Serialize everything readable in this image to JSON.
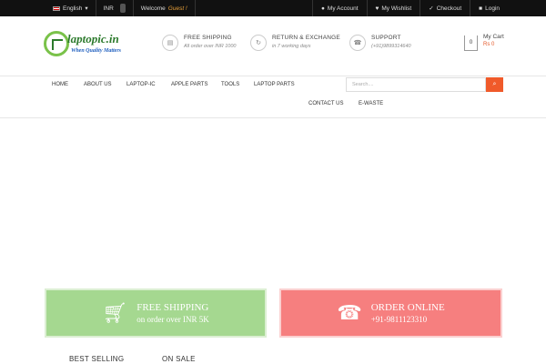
{
  "topbar": {
    "language": "English",
    "currency": "INR",
    "welcome_label": "Welcome",
    "guest_label": "Guest !",
    "my_account": "My Account",
    "my_wishlist": "My Wishlist",
    "checkout": "Checkout",
    "login": "Login"
  },
  "header": {
    "logo_text": "laptopic.in",
    "logo_tagline": "When Quality Matters",
    "features": [
      {
        "title": "FREE SHIPPING",
        "sub": "All order over INR 1000",
        "icon": "truck-icon"
      },
      {
        "title": "RETURN & EXCHANGE",
        "sub": "in 7 working days",
        "icon": "refresh-icon"
      },
      {
        "title": "SUPPORT",
        "sub": "(+91)9899314640",
        "icon": "phone-icon"
      }
    ],
    "cart": {
      "title": "My Cart",
      "count": "0",
      "amount": "Rs 0"
    }
  },
  "nav": {
    "items": [
      "HOME",
      "ABOUT US",
      "LAPTOP-IC",
      "APPLE PARTS",
      "TOOLS",
      "LAPTOP PARTS",
      "CONTACT US",
      "E-WASTE"
    ],
    "search_placeholder": "Search...."
  },
  "promos": [
    {
      "title": "FREE SHIPPING",
      "sub": "on order over INR 5K",
      "icon": "cart-icon",
      "color": "#a5d890"
    },
    {
      "title": "ORDER ONLINE",
      "sub": "+91-9811123310",
      "icon": "phone-icon",
      "color": "#f67f7f"
    }
  ],
  "tabs": [
    "BEST SELLING",
    "ON SALE"
  ],
  "colors": {
    "accent": "#f05a2a",
    "topbar": "#111111"
  }
}
